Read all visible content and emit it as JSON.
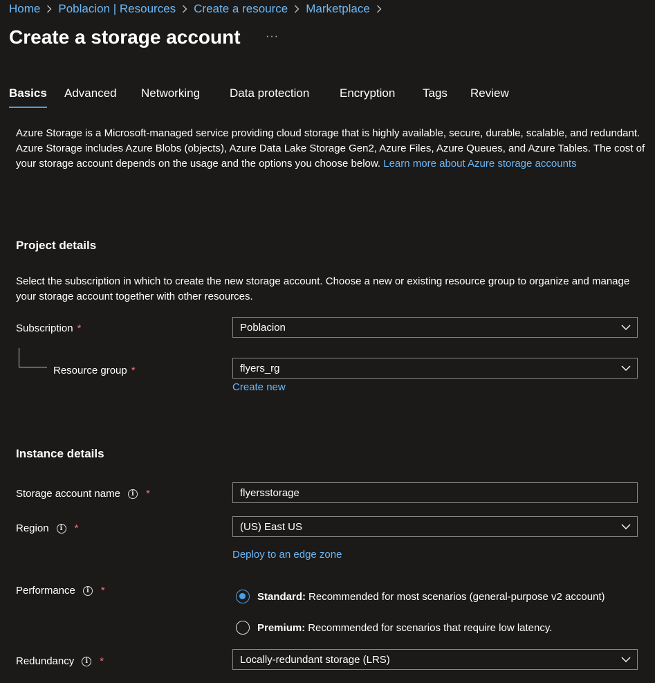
{
  "breadcrumb": [
    "Home",
    "Poblacion | Resources",
    "Create a resource",
    "Marketplace"
  ],
  "page": {
    "title": "Create a storage account",
    "more": "···"
  },
  "tabs": [
    "Basics",
    "Advanced",
    "Networking",
    "Data protection",
    "Encryption",
    "Tags",
    "Review"
  ],
  "active_tab": "Basics",
  "intro": {
    "text": "Azure Storage is a Microsoft-managed service providing cloud storage that is highly available, secure, durable, scalable, and redundant. Azure Storage includes Azure Blobs (objects), Azure Data Lake Storage Gen2, Azure Files, Azure Queues, and Azure Tables. The cost of your storage account depends on the usage and the options you choose below.",
    "link": "Learn more about Azure storage accounts"
  },
  "project": {
    "title": "Project details",
    "description": "Select the subscription in which to create the new storage account. Choose a new or existing resource group to organize and manage your storage account together with other resources.",
    "subscription_label": "Subscription",
    "subscription_value": "Poblacion",
    "resource_group_label": "Resource group",
    "resource_group_value": "flyers_rg",
    "create_new": "Create new"
  },
  "instance": {
    "title": "Instance details",
    "name_label": "Storage account name",
    "name_value": "flyersstorage",
    "region_label": "Region",
    "region_value": "(US) East US",
    "edge_zone_link": "Deploy to an edge zone",
    "performance_label": "Performance",
    "performance_options": [
      {
        "title": "Standard:",
        "desc": "Recommended for most scenarios (general-purpose v2 account)",
        "selected": true
      },
      {
        "title": "Premium:",
        "desc": "Recommended for scenarios that require low latency.",
        "selected": false
      }
    ],
    "redundancy_label": "Redundancy",
    "redundancy_value": "Locally-redundant storage (LRS)"
  },
  "required_marker": "*",
  "info_glyph": "i",
  "colors": {
    "background": "#1b1a19",
    "link": "#6cb8f6",
    "accent": "#4ba0e8",
    "required": "#f1707b"
  },
  "icons": {
    "chevron": "chevron-down-icon",
    "breadcrumb_separator": "chevron-right-icon",
    "info": "info-icon"
  }
}
